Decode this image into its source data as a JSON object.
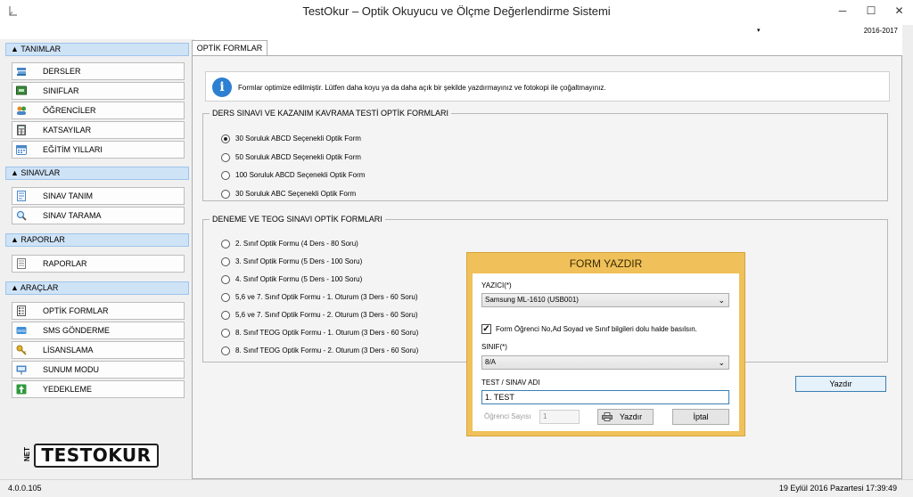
{
  "window": {
    "title": "TestOkur – Optik Okuyucu ve Ölçme Değerlendirme Sistemi",
    "minimize": "─",
    "maximize": "☐",
    "close": "✕"
  },
  "year_selector": {
    "value": "2016-2017",
    "arrow": "▾"
  },
  "sidebar": {
    "sections": [
      {
        "label": "▲ TANIMLAR",
        "items": [
          {
            "label": "DERSLER",
            "icon": "books-icon"
          },
          {
            "label": "SINIFLAR",
            "icon": "classroom-board-icon"
          },
          {
            "label": "ÖĞRENCİLER",
            "icon": "students-icon"
          },
          {
            "label": "KATSAYILAR",
            "icon": "calculator-icon"
          },
          {
            "label": "EĞİTİM YILLARI",
            "icon": "calendar-icon"
          }
        ]
      },
      {
        "label": "▲ SINAVLAR",
        "items": [
          {
            "label": "SINAV TANIM",
            "icon": "exam-form-icon"
          },
          {
            "label": "SINAV TARAMA",
            "icon": "magnifier-icon"
          }
        ]
      },
      {
        "label": "▲ RAPORLAR",
        "items": [
          {
            "label": "RAPORLAR",
            "icon": "report-icon"
          }
        ]
      },
      {
        "label": "▲ ARAÇLAR",
        "items": [
          {
            "label": "OPTİK FORMLAR",
            "icon": "optical-form-icon"
          },
          {
            "label": "SMS GÖNDERME",
            "icon": "sms-icon"
          },
          {
            "label": "LİSANSLAMA",
            "icon": "key-icon"
          },
          {
            "label": "SUNUM MODU",
            "icon": "presentation-icon"
          },
          {
            "label": "YEDEKLEME",
            "icon": "backup-icon"
          }
        ]
      }
    ]
  },
  "logo": {
    "text": "TESTOKUR",
    "side_text": "NET"
  },
  "status": {
    "version": "4.0.0.105",
    "datetime": "19 Eylül 2016 Pazartesi 17:39:49"
  },
  "tab": {
    "label": "OPTİK FORMLAR"
  },
  "info": {
    "text": "Formlar optimize edilmiştir. Lütfen daha koyu ya da daha açık bir şekilde yazdırmayınız ve fotokopi ile çoğaltmayınız.",
    "icon_glyph": "i"
  },
  "group1": {
    "legend": "DERS SINAVI VE KAZANIM KAVRAMA TESTİ OPTİK FORMLARI",
    "options": [
      {
        "label": "30 Soruluk ABCD Seçenekli Optik Form",
        "checked": true
      },
      {
        "label": "50 Soruluk ABCD Seçenekli Optik Form",
        "checked": false
      },
      {
        "label": "100 Soruluk ABCD Seçenekli Optik Form",
        "checked": false
      },
      {
        "label": "30 Soruluk ABC Seçenekli Optik Form",
        "checked": false
      }
    ]
  },
  "group2": {
    "legend": "DENEME VE TEOG SINAVI OPTİK FORMLARI",
    "options": [
      {
        "label": "2. Sınıf Optik Formu (4 Ders - 80 Soru)",
        "checked": false
      },
      {
        "label": "3. Sınıf Optik Formu (5 Ders - 100 Soru)",
        "checked": false
      },
      {
        "label": "4. Sınıf Optik Formu (5 Ders - 100 Soru)",
        "checked": false
      },
      {
        "label": "5,6 ve 7. Sınıf Optik Formu - 1. Oturum (3 Ders - 60 Soru)",
        "checked": false
      },
      {
        "label": "5,6 ve 7. Sınıf Optik Formu - 2. Oturum (3 Ders - 60 Soru)",
        "checked": false
      },
      {
        "label": "8. Sınıf TEOG Optik Formu - 1. Oturum (3 Ders - 60 Soru)",
        "checked": false
      },
      {
        "label": "8. Sınıf TEOG Optik Formu - 2. Oturum (3 Ders - 60 Soru)",
        "checked": false
      }
    ]
  },
  "print_button": {
    "label": "Yazdır"
  },
  "dialog": {
    "title": "FORM YAZDIR",
    "printer_label": "YAZICI(*)",
    "printer_value": "Samsung ML-1610 (USB001)",
    "checkbox_label": "Form Öğrenci No,Ad Soyad ve Sınıf bilgileri dolu halde basılsın.",
    "checkbox_checked": true,
    "checkbox_mark": "✓",
    "class_label": "SINIF(*)",
    "class_value": "8/A",
    "test_label": "TEST / SINAV ADI",
    "test_value": "1. TEST",
    "count_label": "Öğrenci Sayısı",
    "count_value": "1",
    "print_label": "Yazdır",
    "cancel_label": "İptal",
    "chevron": "⌄"
  },
  "colors": {
    "accent": "#2d7fd1",
    "section_header_bg": "#cfe3f7",
    "dialog_frame": "#f0c15a"
  }
}
